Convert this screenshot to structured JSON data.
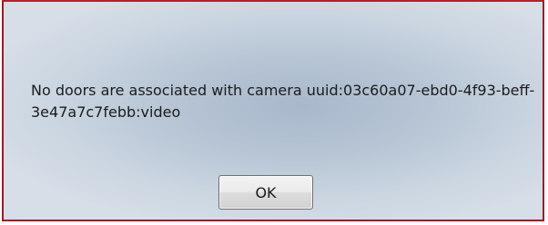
{
  "dialog": {
    "message": "No doors are associated with camera uuid:03c60a07-ebd0-4f93-beff-3e47a7c7febb:video",
    "ok_label": "OK"
  },
  "colors": {
    "frame_border": "#a11a24",
    "background": "#b7c5d5"
  }
}
